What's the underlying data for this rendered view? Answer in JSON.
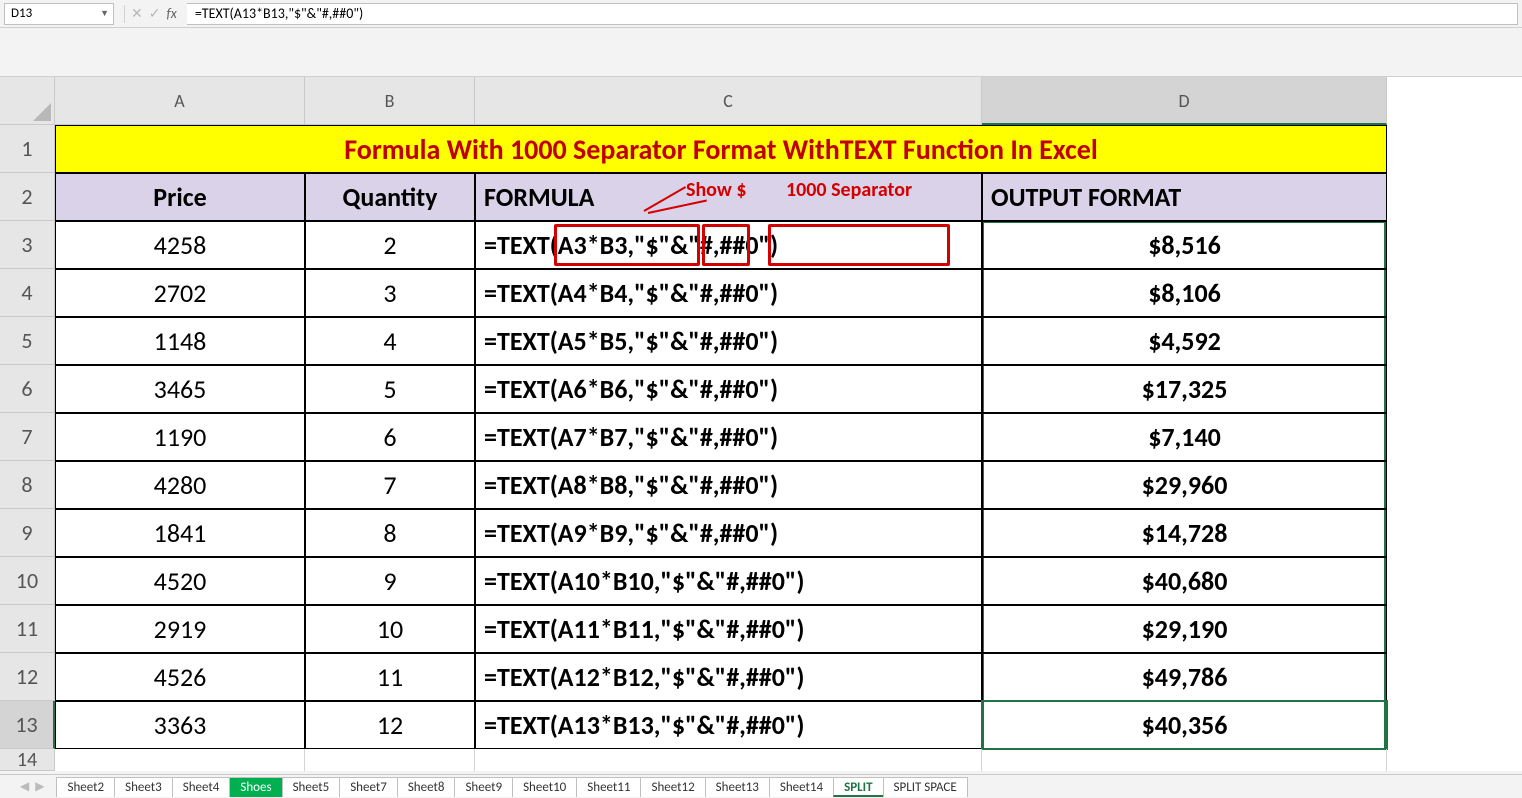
{
  "activeCell": "D13",
  "formulaBar": "=TEXT(A13*B13,\"$\"&\"#,##0\")",
  "fxLabel": "fx",
  "colHeaders": [
    "A",
    "B",
    "C",
    "D"
  ],
  "title": "Formula With 1000 Separator Format WithTEXT Function In Excel",
  "annot": {
    "showDollar": "Show $",
    "sep": "1000 Separator"
  },
  "headers": {
    "price": "Price",
    "qty": "Quantity",
    "formula": "FORMULA",
    "output": "OUTPUT FORMAT"
  },
  "rows": [
    {
      "num": "3",
      "price": "4258",
      "qty": "2",
      "formula": "=TEXT(A3*B3,\"$\"&\"#,##0\")",
      "out": "$8,516"
    },
    {
      "num": "4",
      "price": "2702",
      "qty": "3",
      "formula": "=TEXT(A4*B4,\"$\"&\"#,##0\")",
      "out": "$8,106"
    },
    {
      "num": "5",
      "price": "1148",
      "qty": "4",
      "formula": "=TEXT(A5*B5,\"$\"&\"#,##0\")",
      "out": "$4,592"
    },
    {
      "num": "6",
      "price": "3465",
      "qty": "5",
      "formula": "=TEXT(A6*B6,\"$\"&\"#,##0\")",
      "out": "$17,325"
    },
    {
      "num": "7",
      "price": "1190",
      "qty": "6",
      "formula": "=TEXT(A7*B7,\"$\"&\"#,##0\")",
      "out": "$7,140"
    },
    {
      "num": "8",
      "price": "4280",
      "qty": "7",
      "formula": "=TEXT(A8*B8,\"$\"&\"#,##0\")",
      "out": "$29,960"
    },
    {
      "num": "9",
      "price": "1841",
      "qty": "8",
      "formula": "=TEXT(A9*B9,\"$\"&\"#,##0\")",
      "out": "$14,728"
    },
    {
      "num": "10",
      "price": "4520",
      "qty": "9",
      "formula": "=TEXT(A10*B10,\"$\"&\"#,##0\")",
      "out": "$40,680"
    },
    {
      "num": "11",
      "price": "2919",
      "qty": "10",
      "formula": "=TEXT(A11*B11,\"$\"&\"#,##0\")",
      "out": "$29,190"
    },
    {
      "num": "12",
      "price": "4526",
      "qty": "11",
      "formula": "=TEXT(A12*B12,\"$\"&\"#,##0\")",
      "out": "$49,786"
    },
    {
      "num": "13",
      "price": "3363",
      "qty": "12",
      "formula": "=TEXT(A13*B13,\"$\"&\"#,##0\")",
      "out": "$40,356"
    }
  ],
  "sheetTabs": [
    "Sheet2",
    "Sheet3",
    "Sheet4",
    "Shoes",
    "Sheet5",
    "Sheet7",
    "Sheet8",
    "Sheet9",
    "Sheet10",
    "Sheet11",
    "Sheet12",
    "Sheet13",
    "Sheet14",
    "SPLIT",
    "SPLIT SPACE"
  ],
  "activeSheet": "Shoes",
  "currentSheet": "SPLIT",
  "rowLabels": {
    "r1": "1",
    "r2": "2",
    "r14": "14"
  }
}
